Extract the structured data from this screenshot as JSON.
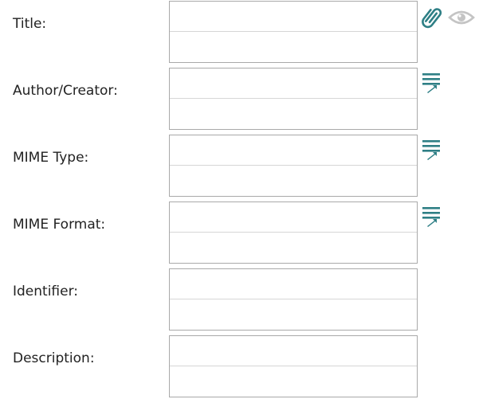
{
  "form": {
    "fields": [
      {
        "label": "Title:",
        "value_line1": "",
        "value_line2": "",
        "icons": [
          "paperclip-icon",
          "eye-icon"
        ]
      },
      {
        "label": "Author/Creator:",
        "value_line1": "",
        "value_line2": "",
        "icons": [
          "list-insert-icon"
        ]
      },
      {
        "label": "MIME Type:",
        "value_line1": "",
        "value_line2": "",
        "icons": [
          "list-insert-icon"
        ]
      },
      {
        "label": "MIME Format:",
        "value_line1": "",
        "value_line2": "",
        "icons": [
          "list-insert-icon"
        ]
      },
      {
        "label": "Identifier:",
        "value_line1": "",
        "value_line2": "",
        "icons": []
      },
      {
        "label": "Description:",
        "value_line1": "",
        "value_line2": "",
        "icons": []
      }
    ]
  },
  "colors": {
    "icon_teal": "#2e7f85",
    "icon_gray": "#c4c4c4",
    "field_border": "#a9a9a9",
    "field_divider": "#d6d6d6",
    "label_text": "#222222"
  }
}
